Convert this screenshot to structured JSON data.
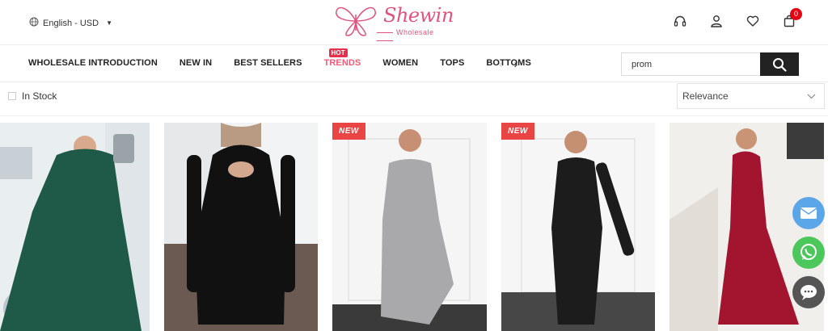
{
  "header": {
    "language": "English - USD",
    "brand": "Shewin",
    "brand_sub": "Wholesale",
    "cart_count": "0"
  },
  "nav": {
    "items": [
      "WHOLESALE INTRODUCTION",
      "NEW IN",
      "BEST SELLERS",
      "TRENDS",
      "WOMEN",
      "TOPS",
      "BOTTOMS"
    ],
    "hot_badge": "HOT"
  },
  "search": {
    "value": "prom"
  },
  "filter": {
    "in_stock_label": "In Stock"
  },
  "sort": {
    "selected": "Relevance"
  },
  "products": [
    {
      "badge": "",
      "dress_color": "#1f5a48"
    },
    {
      "badge": "",
      "dress_color": "#111111"
    },
    {
      "badge": "NEW",
      "dress_color": "#a9a9ab"
    },
    {
      "badge": "NEW",
      "dress_color": "#1c1c1c"
    },
    {
      "badge": "",
      "dress_color": "#a3142f"
    }
  ],
  "colors": {
    "brand_pink": "#e2527e",
    "accent_red": "#e8304d",
    "email_button": "#5ba6e8",
    "whatsapp_button": "#4cc75c",
    "chat_button": "#555555"
  }
}
